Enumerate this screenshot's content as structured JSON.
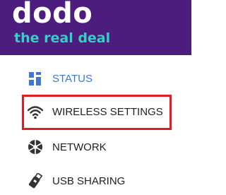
{
  "header": {
    "logo_main": "dodo",
    "logo_tagline": "the real deal",
    "background_color": "#4c1d7f",
    "tagline_color": "#34d0c4"
  },
  "menu": {
    "items": [
      {
        "label": "STATUS",
        "icon": "status-icon",
        "active": true
      },
      {
        "label": "WIRELESS SETTINGS",
        "icon": "wifi-icon",
        "highlighted": true
      },
      {
        "label": "NETWORK",
        "icon": "network-icon"
      },
      {
        "label": "USB SHARING",
        "icon": "usb-icon"
      }
    ],
    "active_color": "#3d78d4",
    "highlight_color": "#e01b24"
  }
}
